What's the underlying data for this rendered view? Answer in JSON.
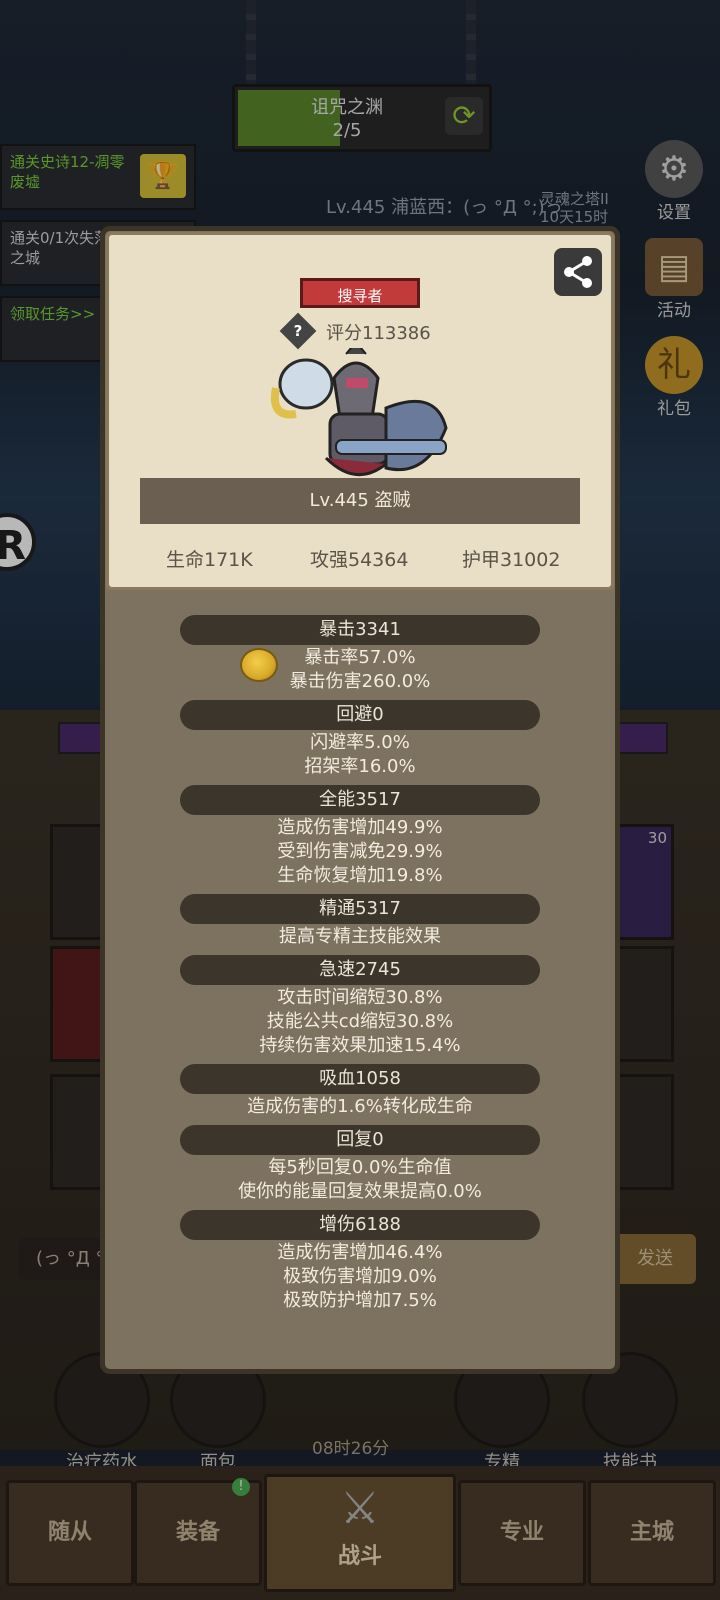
{
  "stage": {
    "name": "诅咒之渊",
    "progress": "2/5"
  },
  "quests": [
    {
      "text": "通关史诗12-凋零废墟",
      "style": "green"
    },
    {
      "text": "通关0/1次失落之城",
      "style": "white"
    },
    {
      "text": "领取任务>>",
      "style": "green"
    }
  ],
  "player_line": "Lv.445 浦蓝西：(っ °Д °;)っ",
  "tower_line": [
    "灵魂之塔II",
    "10天15时"
  ],
  "side_buttons": [
    {
      "label": "设置",
      "icon": "gear-icon"
    },
    {
      "label": "活动",
      "icon": "calendar-icon"
    },
    {
      "label": "礼包",
      "icon": "gift-pack-icon"
    }
  ],
  "chat": {
    "input_text": "(っ °Д °",
    "send_label": "发送"
  },
  "slot_badge": "30",
  "items": [
    {
      "label": "治疗药水",
      "icon": "potion-icon"
    },
    {
      "label": "面包",
      "icon": "bread-icon"
    },
    {
      "label": "专精",
      "icon": "specialization-icon"
    },
    {
      "label": "技能书",
      "icon": "skill-book-icon"
    }
  ],
  "timer": "08时26分",
  "nav": {
    "badge": "!",
    "tabs": [
      "随从",
      "装备",
      "战斗",
      "专业",
      "主城"
    ],
    "active": "战斗"
  },
  "card": {
    "class_badge": "搜寻者",
    "score": "评分113386",
    "level_line": "Lv.445 盗贼",
    "hp": "生命171K",
    "attack": "攻强54364",
    "armor": "护甲31002"
  },
  "stats": [
    {
      "header": "暴击3341",
      "lines": [
        "暴击率57.0%",
        "暴击伤害260.0%"
      ]
    },
    {
      "header": "回避0",
      "lines": [
        "闪避率5.0%",
        "招架率16.0%"
      ]
    },
    {
      "header": "全能3517",
      "lines": [
        "造成伤害增加49.9%",
        "受到伤害减免29.9%",
        "生命恢复增加19.8%"
      ]
    },
    {
      "header": "精通5317",
      "lines": [
        "提高专精主技能效果"
      ]
    },
    {
      "header": "急速2745",
      "lines": [
        "攻击时间缩短30.8%",
        "技能公共cd缩短30.8%",
        "持续伤害效果加速15.4%"
      ]
    },
    {
      "header": "吸血1058",
      "lines": [
        "造成伤害的1.6%转化成生命"
      ]
    },
    {
      "header": "回复0",
      "lines": [
        "每5秒回复0.0%生命值",
        "使你的能量回复效果提高0.0%"
      ]
    },
    {
      "header": "增伤6188",
      "lines": [
        "造成伤害增加46.4%",
        "极致伤害增加9.0%",
        "极致防护增加7.5%"
      ]
    }
  ],
  "colors": {
    "badge_red": "#c23a3a",
    "panel": "#7d7160",
    "card": "#e9dec6",
    "progress_green": "#5b8a2c"
  }
}
